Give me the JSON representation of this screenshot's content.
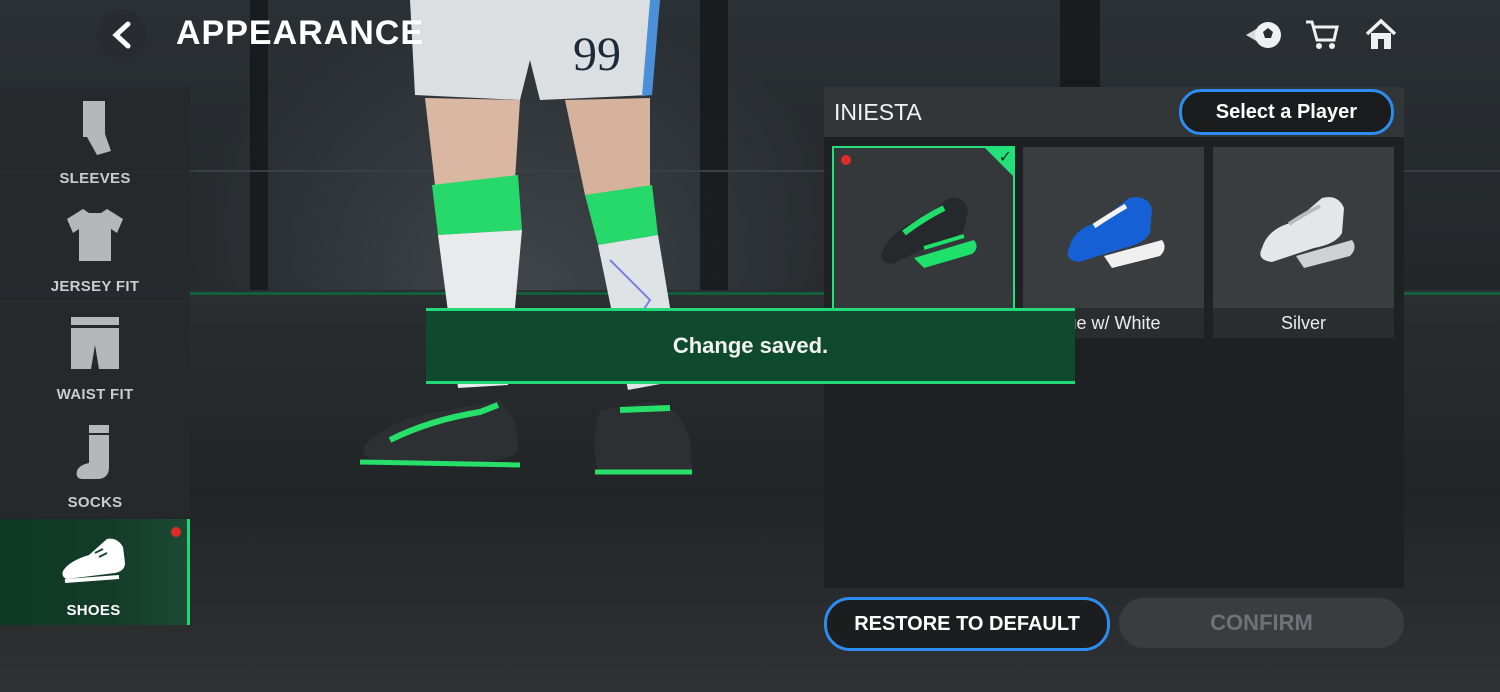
{
  "header": {
    "title": "APPEARANCE",
    "back_icon": "chevron-left-icon",
    "icons": [
      "ball-icon",
      "cart-icon",
      "home-icon"
    ]
  },
  "sidebar": {
    "items": [
      {
        "label": "SLEEVES",
        "icon": "sleeve-icon",
        "active": false
      },
      {
        "label": "JERSEY FIT",
        "icon": "jersey-icon",
        "active": false
      },
      {
        "label": "WAIST FIT",
        "icon": "shorts-icon",
        "active": false
      },
      {
        "label": "SOCKS",
        "icon": "sock-icon",
        "active": false
      },
      {
        "label": "SHOES",
        "icon": "shoe-icon",
        "active": true,
        "notification": true
      }
    ]
  },
  "player": {
    "number": "99"
  },
  "panel": {
    "player_name": "INIESTA",
    "select_player_label": "Select a Player",
    "shoes": [
      {
        "name": "",
        "color": "#1fe06a",
        "selected": true,
        "new": true
      },
      {
        "name": "ue w/ White",
        "color": "#1560d4",
        "selected": false,
        "new": false
      },
      {
        "name": "Silver",
        "color": "#e4e6e8",
        "selected": false,
        "new": false
      }
    ]
  },
  "buttons": {
    "restore_label": "RESTORE TO DEFAULT",
    "confirm_label": "CONFIRM"
  },
  "toast": {
    "message": "Change saved."
  },
  "colors": {
    "accent_green": "#23e07a",
    "accent_blue": "#2c8cf0",
    "notify_red": "#e02a2a"
  }
}
